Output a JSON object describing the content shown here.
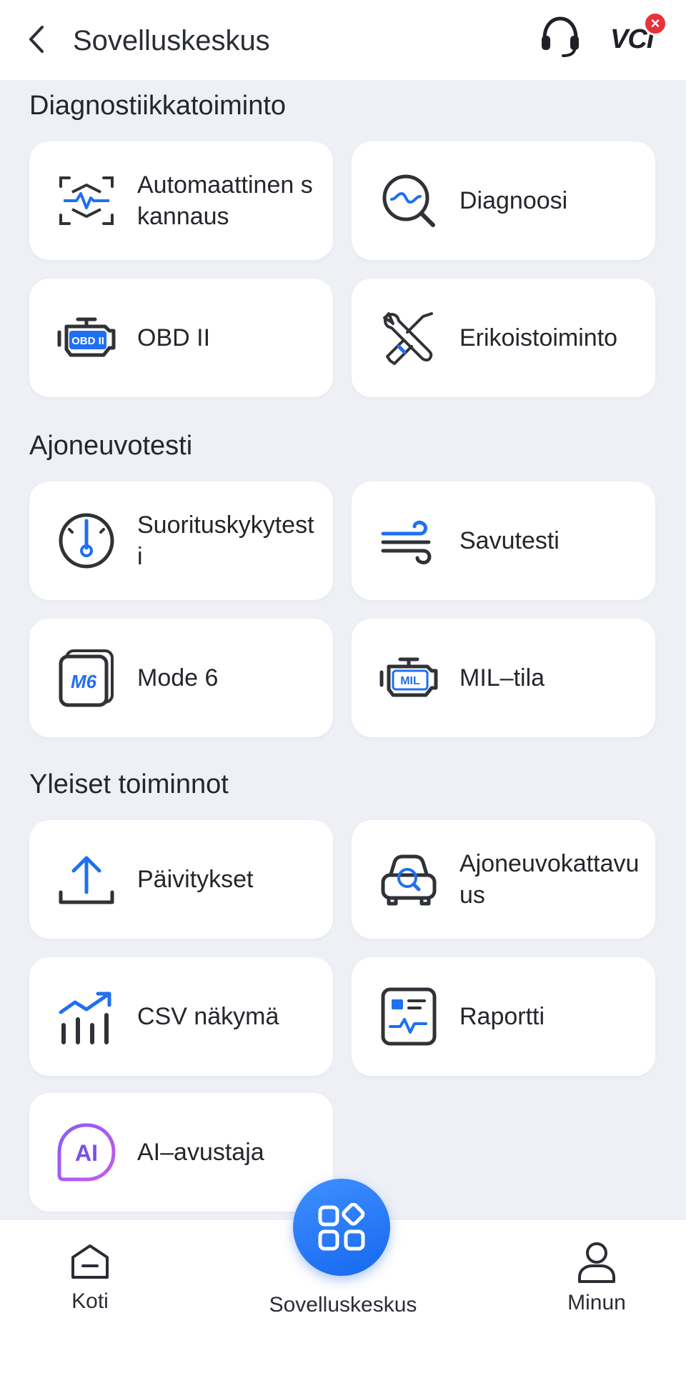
{
  "header": {
    "title": "Sovelluskeskus",
    "vci_label": "VCI",
    "vci_status_badge": "×"
  },
  "sections": [
    {
      "title": "Diagnostiikkatoiminto",
      "cards": [
        {
          "label": "Automaattinen skannaus",
          "icon": "auto-scan-icon"
        },
        {
          "label": "Diagnoosi",
          "icon": "diagnosis-icon"
        },
        {
          "label": "OBD II",
          "icon": "obd2-engine-icon"
        },
        {
          "label": "Erikoistoiminto",
          "icon": "special-function-tools-icon"
        }
      ]
    },
    {
      "title": "Ajoneuvotesti",
      "cards": [
        {
          "label": "Suorituskykytesti",
          "icon": "performance-gauge-icon"
        },
        {
          "label": "Savutesti",
          "icon": "smoke-wind-icon"
        },
        {
          "label": "Mode 6",
          "icon": "mode6-icon"
        },
        {
          "label": "MIL–tila",
          "icon": "mil-engine-icon"
        }
      ]
    },
    {
      "title": "Yleiset toiminnot",
      "cards": [
        {
          "label": "Päivitykset",
          "icon": "upload-update-icon"
        },
        {
          "label": "Ajoneuvokattavuus",
          "icon": "vehicle-coverage-icon"
        },
        {
          "label": "CSV näkymä",
          "icon": "csv-chart-icon"
        },
        {
          "label": "Raportti",
          "icon": "report-icon"
        },
        {
          "label": "AI–avustaja",
          "icon": "ai-assistant-icon"
        }
      ]
    }
  ],
  "nav": {
    "home": "Koti",
    "center": "Sovelluskeskus",
    "me": "Minun"
  },
  "colors": {
    "accent": "#1f6ff2",
    "icon_dark": "#2f3236",
    "background": "#eef0f6",
    "badge": "#e8313a"
  }
}
